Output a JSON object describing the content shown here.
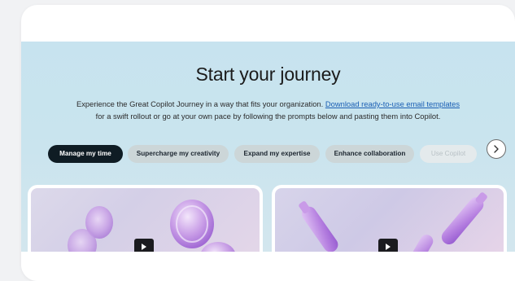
{
  "hero": {
    "title": "Start your journey",
    "description_line1_prefix": "Experience the Great Copilot Journey in a way that fits your organization.",
    "description_link": "Download ready-to-use email templates",
    "description_line2": "for a swift rollout or go at your own pace by following the prompts below and pasting them into Copilot."
  },
  "tabs": [
    {
      "label": "Manage my time",
      "state": "active"
    },
    {
      "label": "Supercharge my creativity",
      "state": "default"
    },
    {
      "label": "Expand my expertise",
      "state": "default"
    },
    {
      "label": "Enhance collaboration",
      "state": "default"
    },
    {
      "label": "Use Copilot",
      "state": "faded"
    }
  ],
  "next_button_icon": "chevron-right-icon",
  "tiles": [
    {
      "icon": "play-icon",
      "image": "purple glass circles"
    },
    {
      "icon": "play-icon",
      "image": "purple glass capsules"
    }
  ],
  "colors": {
    "hero_background": "#c9e4ee",
    "active_tab": "#0f1c24",
    "tab": "#ccd6d8",
    "link": "#1a5fb4"
  }
}
